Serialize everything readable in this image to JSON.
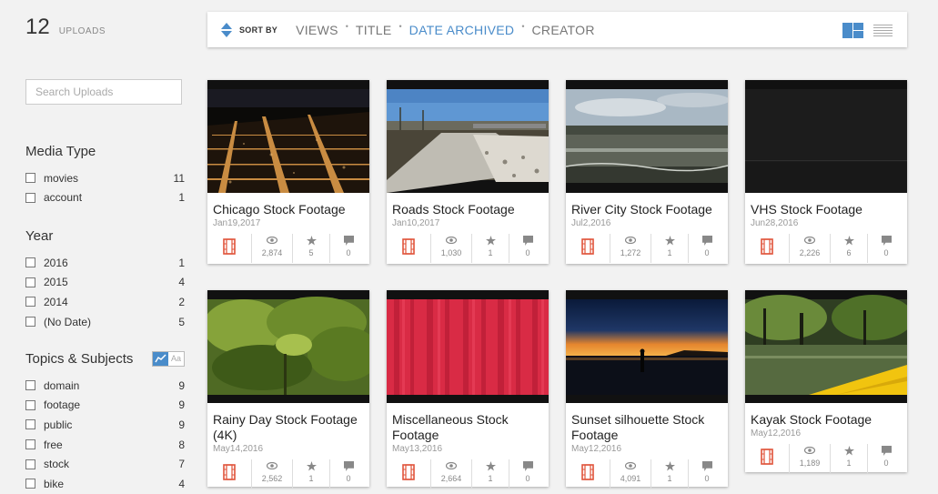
{
  "header": {
    "count": "12",
    "count_label": "UPLOADS"
  },
  "search": {
    "placeholder": "Search Uploads"
  },
  "sort": {
    "label": "SORT BY",
    "options": [
      "VIEWS",
      "TITLE",
      "DATE ARCHIVED",
      "CREATOR"
    ],
    "active": "DATE ARCHIVED",
    "accent": "#4a8cca"
  },
  "facets": {
    "media_type": {
      "title": "Media Type",
      "items": [
        {
          "label": "movies",
          "count": "11"
        },
        {
          "label": "account",
          "count": "1"
        }
      ]
    },
    "year": {
      "title": "Year",
      "items": [
        {
          "label": "2016",
          "count": "1"
        },
        {
          "label": "2015",
          "count": "4"
        },
        {
          "label": "2014",
          "count": "2"
        },
        {
          "label": "(No Date)",
          "count": "5"
        }
      ]
    },
    "topics": {
      "title": "Topics & Subjects",
      "toggle_text": "Aa",
      "items": [
        {
          "label": "domain",
          "count": "9"
        },
        {
          "label": "footage",
          "count": "9"
        },
        {
          "label": "public",
          "count": "9"
        },
        {
          "label": "free",
          "count": "8"
        },
        {
          "label": "stock",
          "count": "7"
        },
        {
          "label": "bike",
          "count": "4"
        }
      ]
    }
  },
  "cards": [
    {
      "title": "Chicago Stock Footage",
      "date": "Jan19,2017",
      "views": "2,874",
      "favs": "5",
      "reviews": "0"
    },
    {
      "title": "Roads Stock Footage",
      "date": "Jan10,2017",
      "views": "1,030",
      "favs": "1",
      "reviews": "0"
    },
    {
      "title": "River City Stock Footage",
      "date": "Jul2,2016",
      "views": "1,272",
      "favs": "1",
      "reviews": "0"
    },
    {
      "title": "VHS Stock Footage",
      "date": "Jun28,2016",
      "views": "2,226",
      "favs": "6",
      "reviews": "0"
    },
    {
      "title": "Rainy Day Stock Footage (4K)",
      "date": "May14,2016",
      "views": "2,562",
      "favs": "1",
      "reviews": "0"
    },
    {
      "title": "Miscellaneous Stock Footage",
      "date": "May13,2016",
      "views": "2,664",
      "favs": "1",
      "reviews": "0"
    },
    {
      "title": "Sunset silhouette Stock Footage",
      "date": "May12,2016",
      "views": "4,091",
      "favs": "1",
      "reviews": "0"
    },
    {
      "title": "Kayak Stock Footage",
      "date": "May12,2016",
      "views": "1,189",
      "favs": "1",
      "reviews": "0"
    }
  ],
  "icons": {
    "media": "film-icon",
    "views": "eye-icon",
    "favorites": "star-icon",
    "reviews": "comment-icon"
  },
  "colors": {
    "film_icon": "#e0533a",
    "stat_icon": "#888888"
  }
}
